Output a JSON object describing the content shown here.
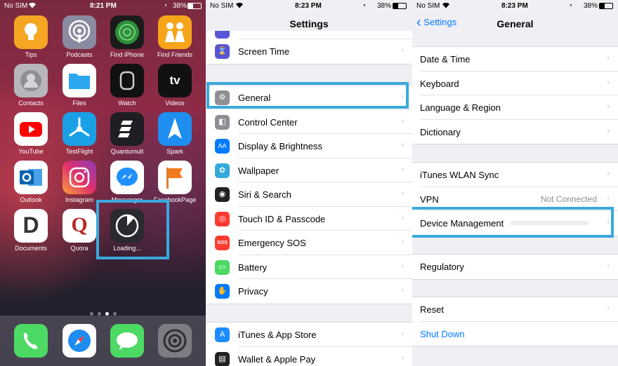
{
  "home": {
    "status": {
      "carrier": "No SIM",
      "time": "8:21 PM",
      "battery": "38%"
    },
    "apps": [
      {
        "label": "Tips"
      },
      {
        "label": "Podcasts"
      },
      {
        "label": "Find iPhone"
      },
      {
        "label": "Find Friends"
      },
      {
        "label": "Contacts"
      },
      {
        "label": "Files"
      },
      {
        "label": "Watch"
      },
      {
        "label": "Videos"
      },
      {
        "label": "YouTube"
      },
      {
        "label": "TestFlight"
      },
      {
        "label": "Quantumult"
      },
      {
        "label": "Spark"
      },
      {
        "label": "Outlook"
      },
      {
        "label": "Instagram"
      },
      {
        "label": "Messenger"
      },
      {
        "label": "FacebookPage"
      },
      {
        "label": "Documents"
      },
      {
        "label": "Quora"
      },
      {
        "label": "Loading..."
      }
    ],
    "tv_label": "tv",
    "dock": [
      "phone-icon",
      "safari-icon",
      "messages-icon",
      "settings-icon"
    ]
  },
  "settings": {
    "status": {
      "carrier": "No SIM",
      "time": "8:23 PM",
      "battery": "38%"
    },
    "title": "Settings",
    "items": [
      {
        "label": "Screen Time",
        "color": "#5856d6"
      },
      {
        "label": "General",
        "color": "#8e8e93"
      },
      {
        "label": "Control Center",
        "color": "#8e8e93"
      },
      {
        "label": "Display & Brightness",
        "color": "#007aff"
      },
      {
        "label": "Wallpaper",
        "color": "#34aadc"
      },
      {
        "label": "Siri & Search",
        "color": "#222222"
      },
      {
        "label": "Touch ID & Passcode",
        "color": "#ff3b30"
      },
      {
        "label": "Emergency SOS",
        "color": "#ff3b30",
        "badge": "SOS"
      },
      {
        "label": "Battery",
        "color": "#4cd964"
      },
      {
        "label": "Privacy",
        "color": "#007aff"
      },
      {
        "label": "iTunes & App Store",
        "color": "#1a8cff"
      },
      {
        "label": "Wallet & Apple Pay",
        "color": "#222222"
      }
    ]
  },
  "general": {
    "status": {
      "carrier": "No SIM",
      "time": "8:23 PM",
      "battery": "38%"
    },
    "back_label": "Settings",
    "title": "General",
    "group1": [
      "Date & Time",
      "Keyboard",
      "Language & Region",
      "Dictionary"
    ],
    "group2": [
      "iTunes WLAN Sync",
      "VPN",
      "Device Management"
    ],
    "vpn_value": "Not Connected",
    "group3": [
      "Regulatory"
    ],
    "group4": [
      "Reset",
      "Shut Down"
    ],
    "shutdown_color": "#007aff"
  }
}
